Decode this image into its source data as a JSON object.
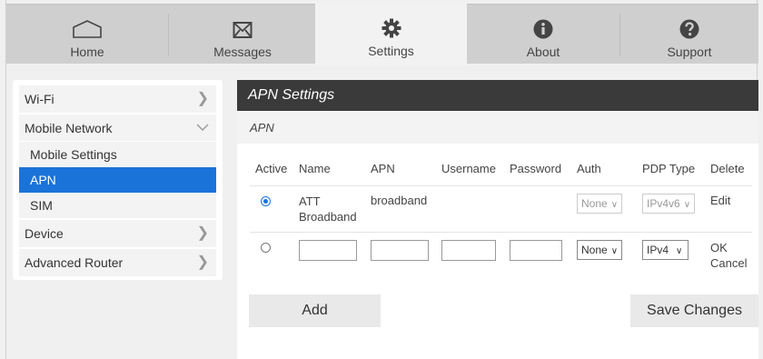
{
  "nav": {
    "tabs": [
      {
        "label": "Home",
        "icon": "home-icon"
      },
      {
        "label": "Messages",
        "icon": "envelope-icon"
      },
      {
        "label": "Settings",
        "icon": "gear-icon"
      },
      {
        "label": "About",
        "icon": "info-icon"
      },
      {
        "label": "Support",
        "icon": "help-icon"
      }
    ],
    "active": "Settings"
  },
  "sidebar": {
    "items": {
      "wifi": "Wi-Fi",
      "mobile_network": "Mobile Network",
      "mobile_settings": "Mobile Settings",
      "apn": "APN",
      "sim": "SIM",
      "device": "Device",
      "advanced_router": "Advanced Router"
    },
    "active": "APN"
  },
  "panel": {
    "title": "APN Settings",
    "section": "APN",
    "columns": [
      "Active",
      "Name",
      "APN",
      "Username",
      "Password",
      "Auth",
      "PDP Type",
      "Delete"
    ],
    "rows": [
      {
        "active": true,
        "name": "ATT Broadband",
        "apn": "broadband",
        "username": "",
        "password": "",
        "auth": "None",
        "pdp_type": "IPv4v6",
        "delete": "Edit"
      }
    ],
    "new_row": {
      "auth": "None",
      "pdp_type": "IPv4",
      "ok": "OK",
      "cancel": "Cancel"
    },
    "add_label": "Add",
    "save_label": "Save Changes"
  },
  "colors": {
    "accent": "#1a73d9",
    "header_bg": "#3a3a3a",
    "nav_bg": "#cfcfcf"
  }
}
